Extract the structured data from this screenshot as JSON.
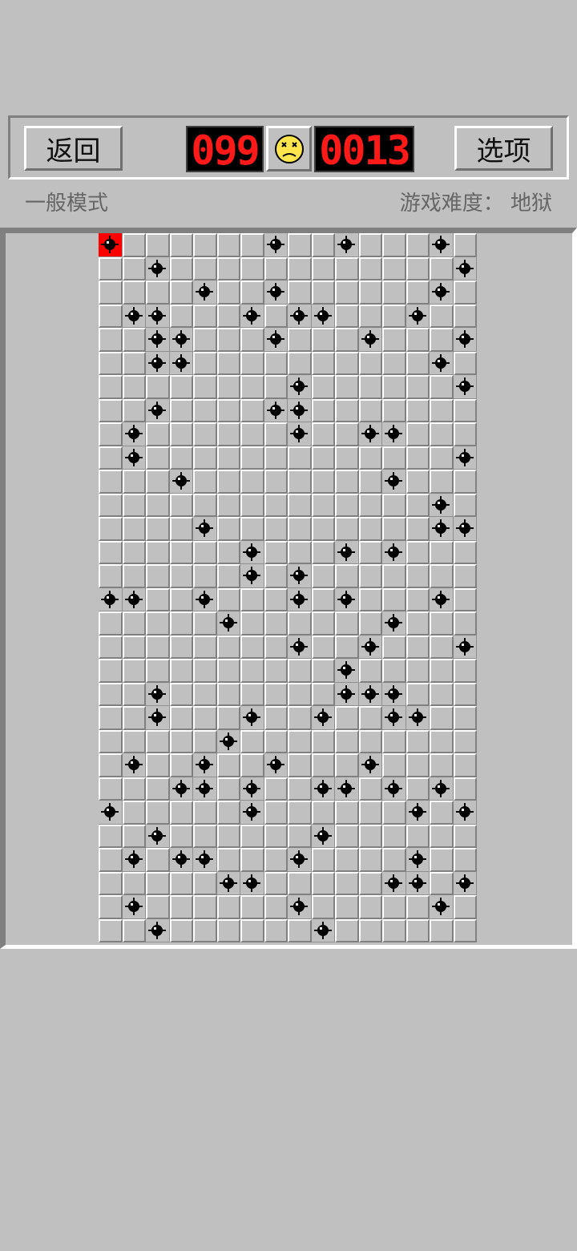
{
  "header": {
    "back_label": "返回",
    "options_label": "选项",
    "mine_counter": "099",
    "timer": "0013",
    "face_icon": "dead-face-icon"
  },
  "info": {
    "mode": "一般模式",
    "difficulty": "游戏难度： 地狱"
  },
  "board": {
    "columns": 16,
    "rows": 30,
    "exploded_cell": [
      0,
      0
    ],
    "mines": [
      [
        0,
        0
      ],
      [
        0,
        7
      ],
      [
        0,
        10
      ],
      [
        0,
        14
      ],
      [
        1,
        2
      ],
      [
        1,
        15
      ],
      [
        2,
        4
      ],
      [
        2,
        7
      ],
      [
        2,
        14
      ],
      [
        3,
        1
      ],
      [
        3,
        2
      ],
      [
        3,
        6
      ],
      [
        3,
        8
      ],
      [
        3,
        9
      ],
      [
        3,
        13
      ],
      [
        4,
        2
      ],
      [
        4,
        3
      ],
      [
        4,
        7
      ],
      [
        4,
        11
      ],
      [
        4,
        15
      ],
      [
        5,
        2
      ],
      [
        5,
        3
      ],
      [
        5,
        14
      ],
      [
        6,
        8
      ],
      [
        6,
        15
      ],
      [
        7,
        2
      ],
      [
        7,
        7
      ],
      [
        7,
        8
      ],
      [
        8,
        1
      ],
      [
        8,
        8
      ],
      [
        8,
        11
      ],
      [
        8,
        12
      ],
      [
        9,
        1
      ],
      [
        9,
        15
      ],
      [
        10,
        3
      ],
      [
        10,
        12
      ],
      [
        11,
        14
      ],
      [
        12,
        4
      ],
      [
        12,
        14
      ],
      [
        12,
        15
      ],
      [
        13,
        6
      ],
      [
        13,
        10
      ],
      [
        13,
        12
      ],
      [
        14,
        6
      ],
      [
        14,
        8
      ],
      [
        15,
        0
      ],
      [
        15,
        1
      ],
      [
        15,
        4
      ],
      [
        15,
        8
      ],
      [
        15,
        10
      ],
      [
        15,
        14
      ],
      [
        16,
        5
      ],
      [
        16,
        12
      ],
      [
        17,
        8
      ],
      [
        17,
        11
      ],
      [
        17,
        15
      ],
      [
        18,
        10
      ],
      [
        19,
        2
      ],
      [
        19,
        10
      ],
      [
        19,
        11
      ],
      [
        19,
        12
      ],
      [
        20,
        2
      ],
      [
        20,
        6
      ],
      [
        20,
        9
      ],
      [
        20,
        12
      ],
      [
        20,
        13
      ],
      [
        21,
        5
      ],
      [
        22,
        1
      ],
      [
        22,
        4
      ],
      [
        22,
        7
      ],
      [
        22,
        11
      ],
      [
        23,
        3
      ],
      [
        23,
        4
      ],
      [
        23,
        6
      ],
      [
        23,
        9
      ],
      [
        23,
        10
      ],
      [
        23,
        12
      ],
      [
        23,
        14
      ],
      [
        24,
        0
      ],
      [
        24,
        6
      ],
      [
        24,
        13
      ],
      [
        24,
        15
      ],
      [
        25,
        2
      ],
      [
        25,
        9
      ],
      [
        26,
        1
      ],
      [
        26,
        3
      ],
      [
        26,
        4
      ],
      [
        26,
        8
      ],
      [
        26,
        13
      ],
      [
        27,
        5
      ],
      [
        27,
        6
      ],
      [
        27,
        12
      ],
      [
        27,
        13
      ],
      [
        27,
        15
      ],
      [
        28,
        1
      ],
      [
        28,
        8
      ],
      [
        28,
        14
      ],
      [
        29,
        2
      ],
      [
        29,
        9
      ]
    ]
  },
  "colors": {
    "background": "#c0c0c0",
    "lcd_digits": "#ff1a1a",
    "exploded": "#ff0000"
  }
}
